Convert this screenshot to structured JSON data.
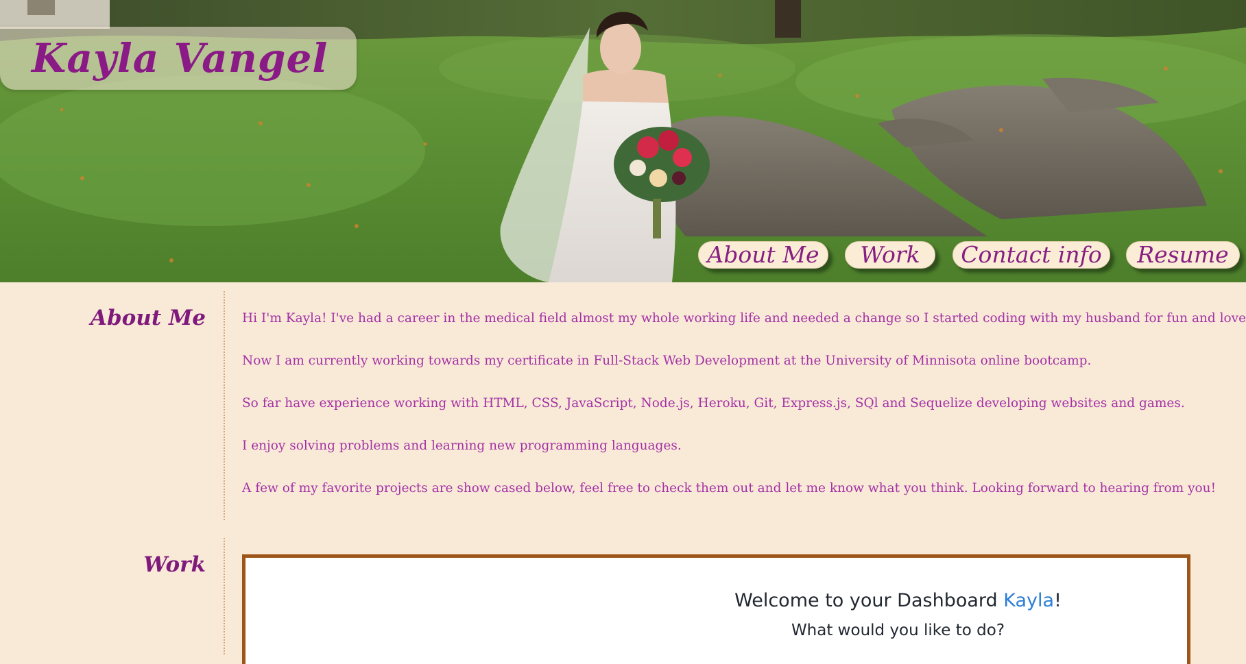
{
  "header": {
    "name": "Kayla Vangel"
  },
  "nav": {
    "items": [
      "About Me",
      "Work",
      "Contact info",
      "Resume"
    ]
  },
  "about": {
    "heading": "About Me",
    "paragraphs": [
      "Hi I'm Kayla! I've had a career in the medical field almost my whole working life and needed a change so I started coding with my husband for fun and loved it.",
      "Now I am currently working towards my certificate in Full-Stack Web Development at the University of Minnisota online bootcamp.",
      "So far have experience working with HTML, CSS, JavaScript, Node.js, Heroku, Git, Express.js, SQl and Sequelize developing websites and games.",
      "I enjoy solving problems and learning new programming languages.",
      "A few of my favorite projects are show cased below, feel free to check them out and let me know what you think. Looking forward to hearing from you!"
    ]
  },
  "work": {
    "heading": "Work",
    "preview": {
      "title_prefix": "Welcome to your Dashboard ",
      "title_name": "Kayla",
      "title_suffix": "!",
      "subtitle": "What would you like to do?"
    }
  },
  "colors": {
    "page_background": "#f9ead7",
    "accent_purple": "#8a1a86",
    "body_text": "#a431a6",
    "frame_border": "#9d5617",
    "dashboard_highlight": "#2c7ed8"
  },
  "icons": {
    "hero": "wedding-photo"
  }
}
